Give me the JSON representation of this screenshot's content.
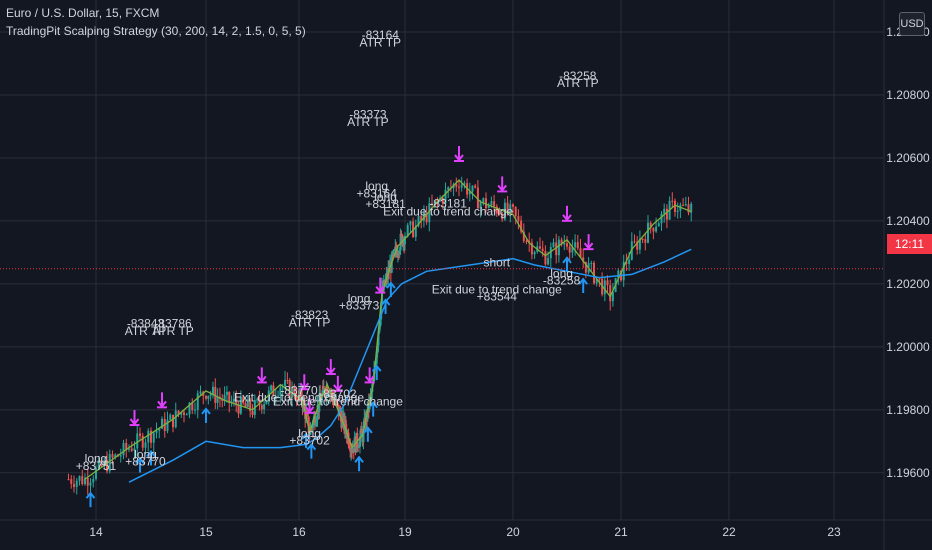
{
  "header": {
    "symbol_title": "Euro / U.S. Dollar, 15, FXCM",
    "strategy_title": "TradingPit Scalping Strategy (30, 200, 14, 2, 1.5, 0, 5, 5)",
    "currency_button": "USD",
    "countdown": "12:11"
  },
  "colors": {
    "background": "#131722",
    "grid": "#2a2e39",
    "candle_up": "#26a69a",
    "candle_down": "#ef5350",
    "ma_fast": "#7cb342",
    "ma_slow": "#2196f3",
    "entry_marker": "#2196f3",
    "exit_marker": "#e040fb",
    "price_line": "#f23645",
    "text": "#d1d4dc"
  },
  "chart_data": {
    "type": "candlestick",
    "x_axis": {
      "labels": [
        "14",
        "15",
        "16",
        "19",
        "20",
        "21",
        "22",
        "23"
      ]
    },
    "y_axis": {
      "labels": [
        "1.21000",
        "1.20800",
        "1.20600",
        "1.20400",
        "1.20200",
        "1.20000",
        "1.19800",
        "1.19600"
      ],
      "ylim": [
        1.1945,
        1.2107
      ]
    },
    "current_price": 1.20248,
    "series": [
      {
        "kind": "line",
        "points": [
          [
            13.9,
            1.1958
          ],
          [
            14.3,
            1.1968
          ],
          [
            14.7,
            1.1977
          ],
          [
            15.0,
            1.1986
          ],
          [
            15.2,
            1.1983
          ],
          [
            15.5,
            1.198
          ],
          [
            15.8,
            1.1988
          ],
          [
            16.1,
            1.1983
          ],
          [
            16.3,
            1.1973
          ],
          [
            16.6,
            1.1983
          ],
          [
            16.8,
            1.1988
          ],
          [
            17.1,
            1.198
          ],
          [
            17.35,
            1.1973
          ],
          [
            17.5,
            1.1968
          ],
          [
            17.8,
            1.1972
          ],
          [
            18.1,
            1.1988
          ],
          [
            18.35,
            1.2017
          ],
          [
            18.6,
            1.2026
          ],
          [
            18.8,
            1.2032
          ],
          [
            19.1,
            1.2038
          ],
          [
            19.3,
            1.2046
          ],
          [
            19.5,
            1.2053
          ],
          [
            19.7,
            1.2046
          ],
          [
            20.0,
            1.2042
          ],
          [
            20.15,
            1.2033
          ],
          [
            20.3,
            1.2029
          ],
          [
            20.5,
            1.2034
          ],
          [
            20.7,
            1.2025
          ],
          [
            20.9,
            1.2016
          ],
          [
            21.1,
            1.2031
          ],
          [
            21.3,
            1.2039
          ],
          [
            21.5,
            1.2045
          ],
          [
            21.65,
            1.2043
          ]
        ]
      },
      {
        "kind": "line",
        "points": [
          [
            14.3,
            1.1957
          ],
          [
            14.7,
            1.1964
          ],
          [
            15.0,
            1.197
          ],
          [
            15.4,
            1.1968
          ],
          [
            15.8,
            1.1968
          ],
          [
            16.2,
            1.1969
          ],
          [
            16.5,
            1.1971
          ],
          [
            16.9,
            1.1975
          ],
          [
            17.3,
            1.1982
          ],
          [
            17.7,
            1.1993
          ],
          [
            18.1,
            1.2004
          ],
          [
            18.5,
            1.2015
          ],
          [
            18.9,
            1.202
          ],
          [
            19.2,
            1.2024
          ],
          [
            19.6,
            1.2026
          ],
          [
            20.0,
            1.2028
          ],
          [
            20.2,
            1.2026
          ],
          [
            20.5,
            1.2024
          ],
          [
            20.8,
            1.2022
          ],
          [
            21.1,
            1.2023
          ],
          [
            21.4,
            1.2027
          ],
          [
            21.65,
            1.2031
          ]
        ]
      }
    ],
    "annotations": [
      {
        "text": "-83843",
        "x": 14.45,
        "y": 1.20061,
        "side": "above"
      },
      {
        "text": "ATR TP",
        "x": 14.45,
        "y": 1.20038,
        "side": "above"
      },
      {
        "text": "-83786",
        "x": 14.7,
        "y": 1.20061,
        "side": "above"
      },
      {
        "text": "ATR TP",
        "x": 14.7,
        "y": 1.20038,
        "side": "above"
      },
      {
        "text": "-83823",
        "x": 16.3,
        "y": 1.20089,
        "side": "above"
      },
      {
        "text": "ATR TP",
        "x": 16.3,
        "y": 1.20065,
        "side": "above"
      },
      {
        "text": "-83770",
        "x": 16.0,
        "y": 1.19849,
        "side": "above"
      },
      {
        "text": "Exit due to trend change",
        "x": 16.0,
        "y": 1.19827,
        "side": "above"
      },
      {
        "text": "-83702",
        "x": 17.1,
        "y": 1.19837,
        "side": "above"
      },
      {
        "text": "Exit due to trend change",
        "x": 17.1,
        "y": 1.19814,
        "side": "above"
      },
      {
        "text": "-83373",
        "x": 17.95,
        "y": 1.20725,
        "side": "above"
      },
      {
        "text": "ATR TP",
        "x": 17.95,
        "y": 1.20702,
        "side": "above"
      },
      {
        "text": "-83164",
        "x": 18.3,
        "y": 1.20978,
        "side": "above"
      },
      {
        "text": "ATR TP",
        "x": 18.3,
        "y": 1.20954,
        "side": "above"
      },
      {
        "text": "-83181",
        "x": 19.4,
        "y": 1.20443,
        "side": "above"
      },
      {
        "text": "Exit due to trend change",
        "x": 19.4,
        "y": 1.20418,
        "side": "above"
      },
      {
        "text": "-83258",
        "x": 20.6,
        "y": 1.20848,
        "side": "above"
      },
      {
        "text": "ATR TP",
        "x": 20.6,
        "y": 1.20826,
        "side": "above"
      },
      {
        "text": "long",
        "x": 14.0,
        "y": 1.19632,
        "side": "below"
      },
      {
        "text": "+83751",
        "x": 14.0,
        "y": 1.19609,
        "side": "below"
      },
      {
        "text": "long",
        "x": 14.45,
        "y": 1.19646,
        "side": "below"
      },
      {
        "text": "+83770",
        "x": 14.45,
        "y": 1.19623,
        "side": "below"
      },
      {
        "text": "long",
        "x": 16.3,
        "y": 1.19712,
        "side": "below"
      },
      {
        "text": "+83702",
        "x": 16.3,
        "y": 1.1969,
        "side": "below"
      },
      {
        "text": "long",
        "x": 17.7,
        "y": 1.20141,
        "side": "below"
      },
      {
        "text": "+83373",
        "x": 17.7,
        "y": 1.20118,
        "side": "below"
      },
      {
        "text": "long",
        "x": 18.2,
        "y": 1.20498,
        "side": "below"
      },
      {
        "text": "+83164",
        "x": 18.2,
        "y": 1.20475,
        "side": "below"
      },
      {
        "text": "long",
        "x": 18.45,
        "y": 1.20463,
        "side": "below"
      },
      {
        "text": "+83181",
        "x": 18.45,
        "y": 1.20441,
        "side": "below"
      },
      {
        "text": "short",
        "x": 19.85,
        "y": 1.20256,
        "side": "below"
      },
      {
        "text": "Exit due to trend change",
        "x": 19.85,
        "y": 1.2017,
        "side": "below"
      },
      {
        "text": "+83544",
        "x": 19.85,
        "y": 1.20147,
        "side": "below"
      },
      {
        "text": "long",
        "x": 20.45,
        "y": 1.2022,
        "side": "below"
      },
      {
        "text": "-83258",
        "x": 20.45,
        "y": 1.20198,
        "side": "below"
      }
    ],
    "entry_markers_x": [
      13.95,
      14.4,
      14.5,
      15.0,
      16.2,
      16.35,
      17.7,
      17.95,
      18.1,
      18.2,
      18.45,
      18.6,
      20.5,
      20.65
    ],
    "exit_markers_x": [
      14.35,
      14.6,
      15.6,
      16.15,
      16.3,
      16.9,
      17.1,
      18.0,
      18.3,
      19.5,
      19.9,
      20.5,
      20.7
    ]
  }
}
